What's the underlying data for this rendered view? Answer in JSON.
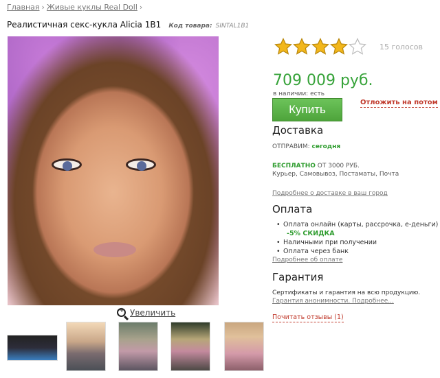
{
  "breadcrumb": {
    "home": "Главная",
    "category": "Живые куклы Real Doll",
    "separator": "›"
  },
  "product": {
    "title": "Реалистичная секс-кукла Alicia 1B1",
    "sku_label": "Код товара:",
    "sku_value": "SINTAL1B1"
  },
  "gallery": {
    "zoom_label": "Увеличить",
    "thumbnail_count": 5
  },
  "rating": {
    "stars_filled": 4,
    "stars_total": 5,
    "votes_text": "15 голосов"
  },
  "price": {
    "value": "709 009 руб.",
    "stock_text": "в наличии: есть"
  },
  "actions": {
    "buy_label": "Купить",
    "later_label": "Отложить на потом"
  },
  "delivery": {
    "heading": "Доставка",
    "ship_label": "ОТПРАВИМ:",
    "ship_value": "сегодня",
    "free_label": "БЕСПЛАТНО",
    "free_condition": "ОТ 3000 РУБ.",
    "methods": "Курьер, Самовывоз, Постаматы, Почта",
    "more_link": "Подробнее о доставке в ваш город"
  },
  "payment": {
    "heading": "Оплата",
    "items": [
      "Оплата онлайн (карты, рассрочка, е-деньги)",
      "-5% СКИДКА",
      "Наличными при получении",
      "Оплата через банк"
    ],
    "more_link": "Подробнее об оплате"
  },
  "warranty": {
    "heading": "Гарантия",
    "text": "Сертификаты и гарантия на всю продукцию.",
    "anon_link": "Гарантия анонимности. Подробнее..."
  },
  "reviews": {
    "link": "Почитать отзывы (1)"
  },
  "colors": {
    "accent_green": "#37a33a",
    "link_red": "#c0392b",
    "star_gold": "#f2b71c"
  }
}
